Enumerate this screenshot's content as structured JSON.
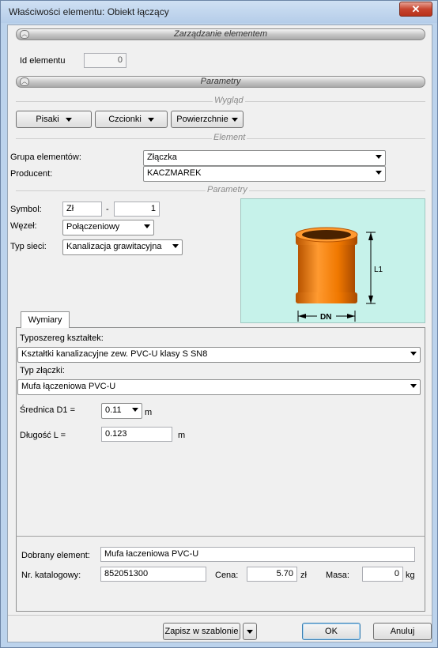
{
  "window": {
    "title": "Właściwości elementu: Obiekt łączący",
    "close_glyph": "✕"
  },
  "management": {
    "section_label": "Zarządzanie elementem",
    "id_label": "Id elementu",
    "id_value": "0"
  },
  "parameters_section": {
    "section_label": "Parametry"
  },
  "appearance": {
    "group_title": "Wygląd",
    "pens_label": "Pisaki",
    "fonts_label": "Czcionki",
    "surfaces_label": "Powierzchnie"
  },
  "element": {
    "group_title": "Element",
    "group_label": "Grupa elementów:",
    "group_value": "Złączka",
    "producer_label": "Producent:",
    "producer_value": "KACZMAREK"
  },
  "params": {
    "group_title": "Parametry",
    "symbol_label": "Symbol:",
    "symbol_prefix": "Zł",
    "symbol_dash": "-",
    "symbol_number": "1",
    "node_label": "Węzeł:",
    "node_value": "Połączeniowy",
    "network_label": "Typ sieci:",
    "network_value": "Kanalizacja grawitacyjna"
  },
  "preview": {
    "dn_label": "DN",
    "l1_label": "L1",
    "pipe_color": "#f07800"
  },
  "dimensions": {
    "tab_label": "Wymiary",
    "series_label": "Typoszereg kształtek:",
    "series_value": "Kształtki kanalizacyjne zew. PVC-U klasy S SN8",
    "fitting_type_label": "Typ złączki:",
    "fitting_type_value": "Mufa łączeniowa PVC-U",
    "d1_label": "Średnica D1 =",
    "d1_value": "0.11",
    "d1_unit": "m",
    "length_label": "Długość L =",
    "length_value": "0.123",
    "length_unit": "m",
    "selected_label": "Dobrany element:",
    "selected_value": "Mufa łaczeniowa PVC-U",
    "catalog_label": "Nr. katalogowy:",
    "catalog_value": "852051300",
    "price_label": "Cena:",
    "price_value": "5.70",
    "price_unit": "zł",
    "mass_label": "Masa:",
    "mass_value": "0",
    "mass_unit": "kg"
  },
  "footer": {
    "save_template_label": "Zapisz w szablonie",
    "ok_label": "OK",
    "cancel_label": "Anuluj"
  }
}
